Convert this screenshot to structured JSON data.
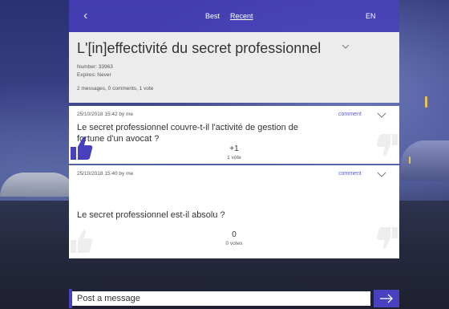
{
  "nav": {
    "back_icon": "chevron-left-icon",
    "tabs": [
      {
        "label": "Best",
        "active": false
      },
      {
        "label": "Recent",
        "active": true
      }
    ],
    "language": "EN"
  },
  "thread": {
    "title": "L'[in]effectivité du secret professionnel",
    "number": "Number: 33963",
    "expires": "Expires: Never",
    "stats": "2 messages, 0 comments, 1 vote"
  },
  "messages": [
    {
      "meta": "25/10/2018 15:42 by me",
      "comment_label": "comment",
      "text_line1": "Le secret professionnel couvre-t-il l'activité de gestion de",
      "text_line2": "fortune d'un avocat ?",
      "score": "+1",
      "votes": "1 vote",
      "upvoted": true
    },
    {
      "meta": "25/10/2018 15:40 by me",
      "comment_label": "comment",
      "text_line1": "Le secret professionnel est-il absolu ?",
      "score": "0",
      "votes": "0 votes",
      "upvoted": false
    }
  ],
  "composer": {
    "placeholder": "Post a message",
    "send_icon": "arrow-right-icon"
  },
  "colors": {
    "accent": "#4840be",
    "link": "#5b5fd6",
    "thumb_active": "#4840be",
    "thumb_inactive": "#eeeeee"
  }
}
